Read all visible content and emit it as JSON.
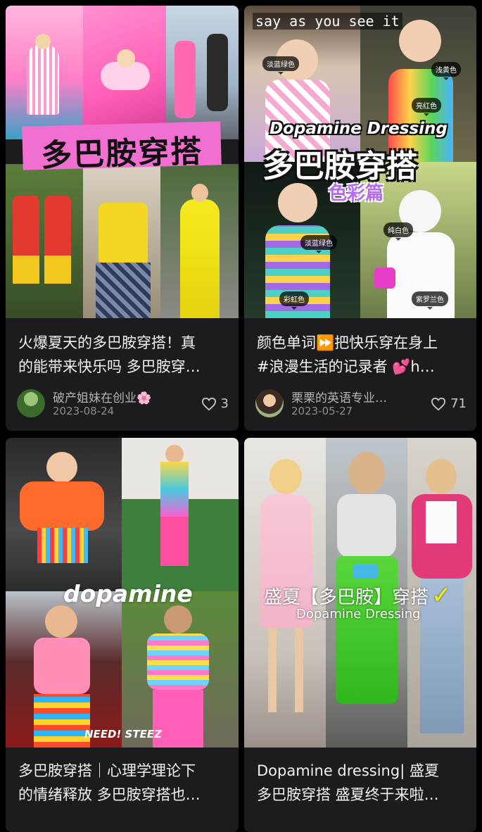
{
  "feed": {
    "cards": [
      {
        "title_line1": "火爆夏天的多巴胺穿搭！真",
        "title_line2": "的能带来快乐吗 多巴胺穿…",
        "author": "破产姐妹在创业🌸",
        "date": "2023-08-24",
        "likes": "3",
        "cover_text": "多巴胺穿搭"
      },
      {
        "title_line1": "颜色单词⏩把快乐穿在身上",
        "title_line2": "#浪漫生活的记录者 💕h…",
        "author": "栗栗的英语专业…",
        "date": "2023-05-27",
        "likes": "71",
        "cover_top": "say as you see it",
        "cover_en": "Dopamine Dressing",
        "cover_zh": "多巴胺穿搭",
        "cover_sub": "色彩篇",
        "tags": [
          "淡蓝绿色",
          "浅黄色",
          "亮红色",
          "淡蓝绿色",
          "纯白色",
          "彩虹色",
          "紫罗兰色"
        ]
      },
      {
        "title_line1": "多巴胺穿搭｜心理学理论下",
        "title_line2": "的情绪释放 多巴胺穿搭也…",
        "cover_text": "dopamine",
        "cover_watermark": "NEED! STEEZ"
      },
      {
        "title_line1": "Dopamine dressing|  盛夏",
        "title_line2": "多巴胺穿搭 盛夏终于来啦…",
        "cover_zh": "盛夏【多巴胺】穿搭",
        "cover_check": "✓",
        "cover_en": "Dopamine Dressing"
      }
    ]
  },
  "colors": {
    "background": "#000000",
    "card": "#1c1c1e",
    "pink_banner": "#f16fd0",
    "title": "#f2f2f2",
    "meta": "#8d8d8d"
  }
}
